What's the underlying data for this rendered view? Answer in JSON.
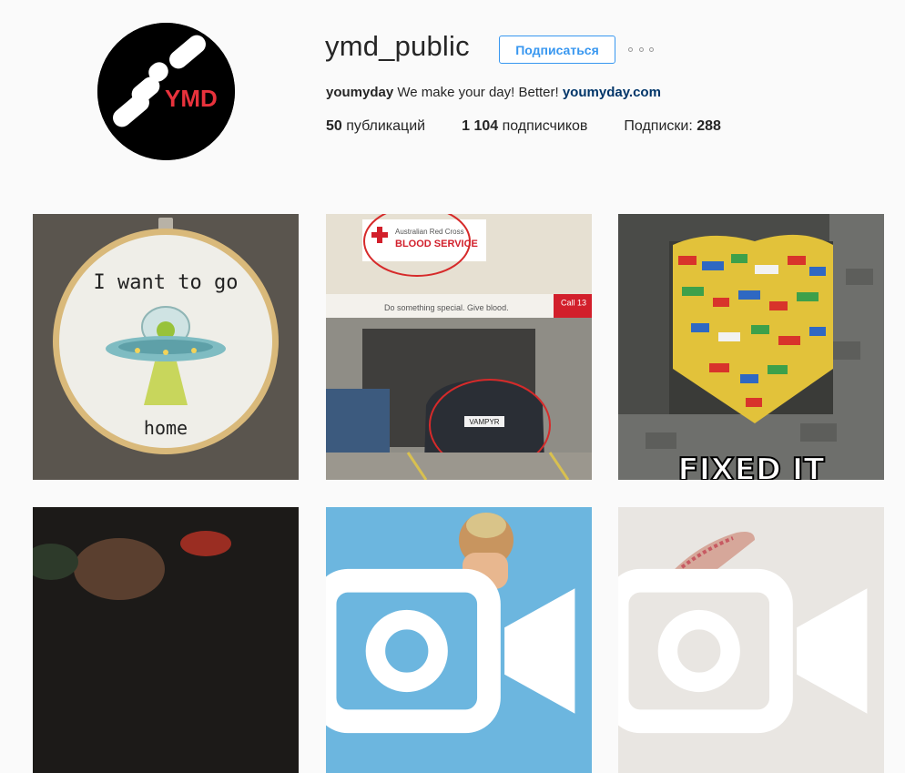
{
  "profile": {
    "username": "ymd_public",
    "follow_label": "Подписаться",
    "more_icon": "ellipsis-icon",
    "avatar_text": "YMD",
    "bio": {
      "full_name": "youmyday",
      "text": " We make your day! Better! ",
      "link": "youmyday.com"
    },
    "stats": {
      "posts_count": "50",
      "posts_label": " публикаций",
      "followers_count": "1 104",
      "followers_label": " подписчиков",
      "following_label": "Подписки: ",
      "following_count": "288"
    }
  },
  "posts": [
    {
      "kind": "image",
      "text_top": "I want to go",
      "text_bottom": "home"
    },
    {
      "kind": "image",
      "sign_text": "Australian Red Cross",
      "sign_title": "BLOOD SERVICE",
      "banner_text": "Do something special. Give blood.",
      "call_text": "Call 13",
      "plate_text": "VAMPYR"
    },
    {
      "kind": "image",
      "caption": "FIXED IT"
    },
    {
      "kind": "image"
    },
    {
      "kind": "video",
      "icon": "video-camera-icon"
    },
    {
      "kind": "video",
      "icon": "video-camera-icon"
    }
  ],
  "colors": {
    "accent": "#3897f0",
    "link": "#003569",
    "background": "#fafafa",
    "text": "#262626",
    "avatar_red": "#e8323c"
  }
}
